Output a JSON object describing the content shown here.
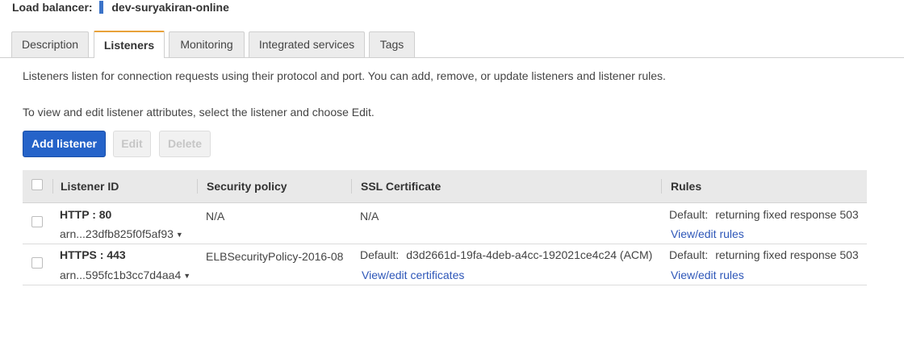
{
  "header": {
    "label": "Load balancer:",
    "name": "dev-suryakiran-online"
  },
  "tabs": [
    {
      "label": "Description",
      "active": false
    },
    {
      "label": "Listeners",
      "active": true
    },
    {
      "label": "Monitoring",
      "active": false
    },
    {
      "label": "Integrated services",
      "active": false
    },
    {
      "label": "Tags",
      "active": false
    }
  ],
  "intro": {
    "line1": "Listeners listen for connection requests using their protocol and port. You can add, remove, or update listeners and listener rules.",
    "line2": "To view and edit listener attributes, select the listener and choose Edit."
  },
  "toolbar": {
    "add_label": "Add listener",
    "edit_label": "Edit",
    "delete_label": "Delete"
  },
  "table": {
    "columns": [
      "Listener ID",
      "Security policy",
      "SSL Certificate",
      "Rules"
    ],
    "rows": [
      {
        "listener": "HTTP : 80",
        "arn": "arn...23dfb825f0f5af93",
        "policy": "N/A",
        "ssl": "N/A",
        "ssl_link": "",
        "rules_label": "Default:",
        "rules_value": "returning fixed response 503",
        "rules_link": "View/edit rules"
      },
      {
        "listener": "HTTPS : 443",
        "arn": "arn...595fc1b3cc7d4aa4",
        "policy": "ELBSecurityPolicy-2016-08",
        "ssl_label": "Default:",
        "ssl_value": "d3d2661d-19fa-4deb-a4cc-192021ce4c24 (ACM)",
        "ssl_link": "View/edit certificates",
        "rules_label": "Default:",
        "rules_value": "returning fixed response 503",
        "rules_link": "View/edit rules"
      }
    ]
  },
  "colors": {
    "primary_button": "#2563c9",
    "link": "#2d56b8",
    "active_tab_accent": "#e8a23a"
  }
}
